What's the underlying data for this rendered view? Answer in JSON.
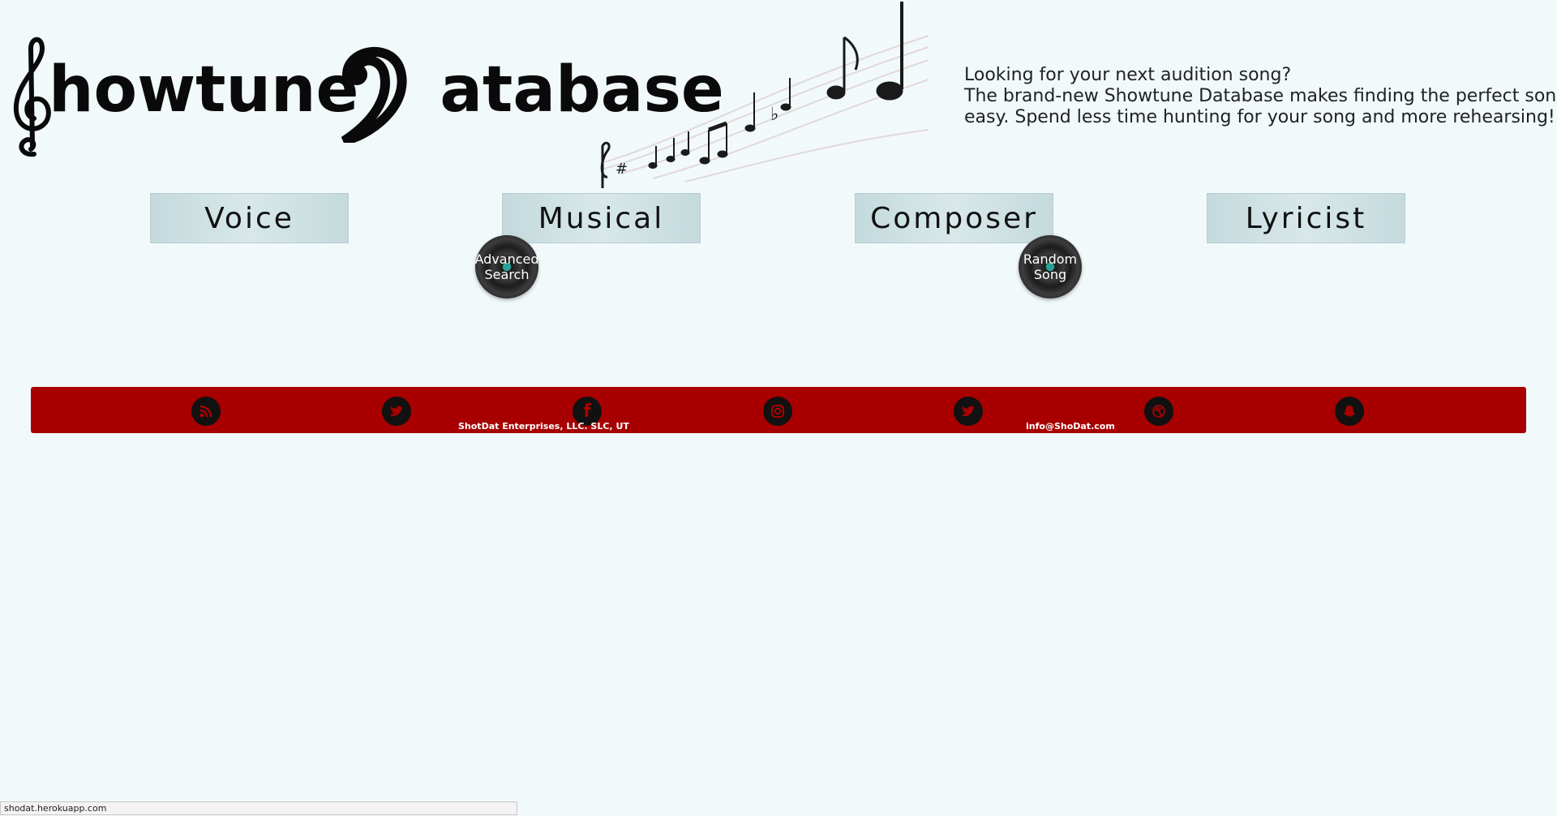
{
  "header": {
    "logo_word1": "howtune",
    "logo_word2": "atabase"
  },
  "tagline": {
    "line1": "Looking for your next audition song?",
    "line2": "The brand-new Showtune Database makes finding the perfect song",
    "line3": "easy. Spend less time hunting for your song and more rehearsing!"
  },
  "nav": {
    "voice": "Voice",
    "musical": "Musical",
    "composer": "Composer",
    "lyricist": "Lyricist"
  },
  "discs": {
    "advanced_line1": "Advanced",
    "advanced_line2": "Search",
    "random_line1": "Random",
    "random_line2": "Song"
  },
  "footer": {
    "company": "ShotDat Enterprises, LLC. SLC, UT",
    "email": "info@ShoDat.com",
    "icons": [
      "rss-icon",
      "twitter-icon",
      "facebook-icon",
      "instagram-icon",
      "twitter-icon",
      "dribbble-icon",
      "snapchat-icon"
    ],
    "background_color": "#a80000"
  },
  "status_bar": {
    "url": "shodat.herokuapp.com"
  }
}
